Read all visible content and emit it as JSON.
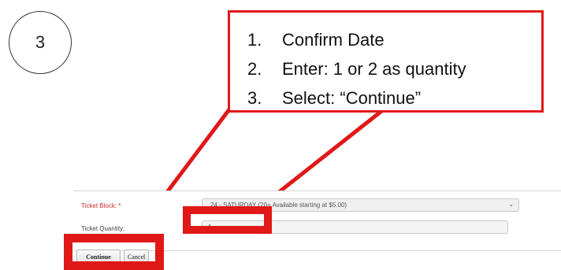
{
  "step_number": "3",
  "instructions": [
    {
      "num": "1.",
      "text": "Confirm Date"
    },
    {
      "num": "2.",
      "text": "Enter: 1 or 2 as quantity"
    },
    {
      "num": "3.",
      "text": "Select: “Continue”"
    }
  ],
  "form": {
    "ticket_block_label": "Ticket Block: *",
    "ticket_block_value": "2024 - SATURDAY (20+ Available starting at $5.00)",
    "ticket_block_visible": "24 - SATURDAY (20+ Available starting at $5.00)",
    "ticket_quantity_label": "Ticket Quantity:",
    "ticket_quantity_value": "1"
  },
  "buttons": {
    "continue": "Continue",
    "cancel": "Cancel"
  },
  "colors": {
    "highlight": "#e01818"
  }
}
